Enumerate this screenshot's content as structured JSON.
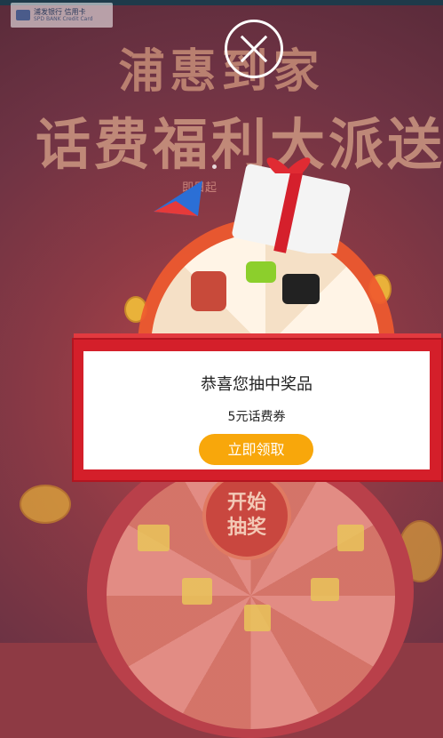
{
  "bank": {
    "name_cn": "浦发银行",
    "name_en": "SPD BANK",
    "card_cn": "信用卡",
    "card_en": "Credit Card"
  },
  "campaign": {
    "title_line1": "浦惠到家",
    "title_line2": "话费福利大派送",
    "subtitle": "即日起"
  },
  "wheel": {
    "start_label_line1": "开始",
    "start_label_line2": "抽奖"
  },
  "modal": {
    "title": "恭喜您抽中奖品",
    "prize": "5元话费券",
    "claim_button": "立即领取"
  },
  "colors": {
    "modal_frame": "#d41f2a",
    "claim_button": "#f8a70b",
    "wheel_rim": "#ef5a2f"
  },
  "icons": {
    "close": "close-icon",
    "gift": "gift-box-icon",
    "coin": "gold-coin-icon",
    "iqiyi": "iqiyi-icon",
    "movie": "movie-clapper-icon",
    "food": "food-cup-icon"
  }
}
